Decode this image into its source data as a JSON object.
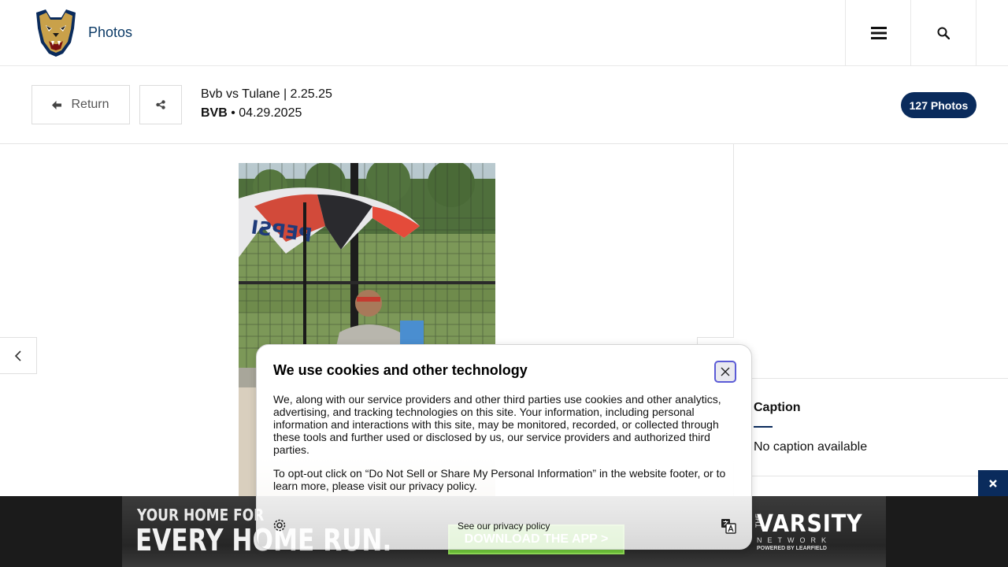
{
  "header": {
    "site_title": "Photos",
    "logo_icon": "panther-logo",
    "menu_icon": "hamburger-menu-icon",
    "search_icon": "search-icon"
  },
  "gallery": {
    "return_label": "Return",
    "title": "Bvb vs Tulane | 2.25.25",
    "sport": "BVB",
    "separator": " • ",
    "date": "04.29.2025",
    "photo_count": "127 Photos"
  },
  "side_panel": {
    "caption_label": "Caption",
    "caption_text": "No caption available"
  },
  "cookie": {
    "title": "We use cookies and other technology",
    "paragraph1": "We, along with our service providers and other third parties use cookies and other analytics, advertising, and tracking technologies on this site. Your information, including personal information and interactions with this site, may be monitored, recorded, or collected through these tools and further used or disclosed by us, our service providers and authorized third parties.",
    "paragraph2": "To opt-out click on “Do Not Sell or Share My Personal Information” in the website footer, or to learn more, please visit our privacy policy.",
    "privacy_link": "See our privacy policy"
  },
  "ad": {
    "line1": "YOUR HOME FOR",
    "line2": "EVERY HOME RUN.",
    "cta": "DOWNLOAD THE APP >",
    "brand_the": "THE",
    "brand": "VARSITY",
    "brand_network": "NETWORK",
    "brand_powered": "POWERED BY LEARFIELD"
  },
  "colors": {
    "navy": "#0a2b5c",
    "title_blue": "#0b3a66",
    "cta_green": "#6fc43a"
  }
}
